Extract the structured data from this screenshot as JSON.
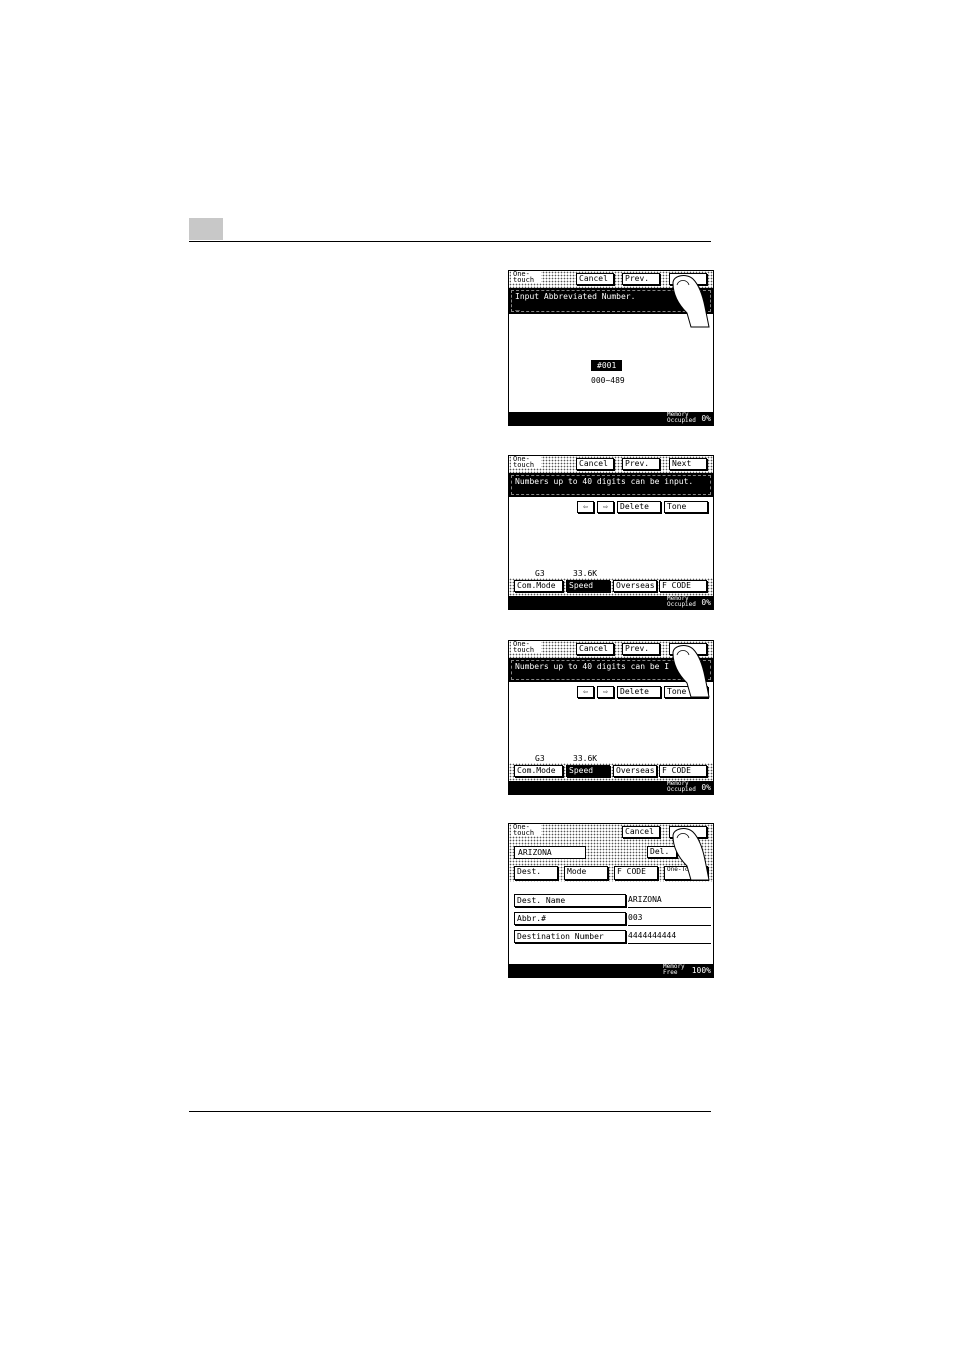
{
  "screen1": {
    "one_touch": "One-touch",
    "cancel": "Cancel",
    "prev": "Prev.",
    "message": "Input Abbreviated Number.",
    "cursor": "_",
    "abbr_number": "#001",
    "range": "000~489",
    "memory_label": "Memory Occupied",
    "memory_value": "0%"
  },
  "screen2": {
    "one_touch": "One-touch",
    "cancel": "Cancel",
    "prev": "Prev.",
    "next": "Next",
    "message": "Numbers up to 40 digits can be input.",
    "left_arrow": "⇦",
    "right_arrow": "⇨",
    "delete": "Delete",
    "tone": "Tone",
    "g3": "G3",
    "speed_value": "33.6K",
    "com_mode": "Com.Mode",
    "speed": "Speed",
    "overseas": "Overseas",
    "f_code": "F CODE",
    "memory_label": "Memory Occupied",
    "memory_value": "0%"
  },
  "screen3": {
    "one_touch": "One-touch",
    "cancel": "Cancel",
    "prev": "Prev.",
    "message": "Numbers up to 40 digits can be I",
    "left_arrow": "⇦",
    "right_arrow": "⇨",
    "delete": "Delete",
    "tone": "Tone",
    "g3": "G3",
    "speed_value": "33.6K",
    "com_mode": "Com.Mode",
    "speed": "Speed",
    "overseas": "Overseas",
    "f_code": "F CODE",
    "memory_label": "Memory Occupied",
    "memory_value": "0%"
  },
  "screen4": {
    "one_touch": "One-touch",
    "cancel": "Cancel",
    "name_box": "ARIZONA",
    "del": "Del.",
    "tabs": {
      "dest": "Dest.",
      "mode": "Mode",
      "f_code": "F CODE",
      "one_touch": "One-Touch"
    },
    "fields": [
      {
        "label": "Dest. Name",
        "value": "ARIZONA"
      },
      {
        "label": "Abbr.#",
        "value": "003"
      },
      {
        "label": "Destination Number",
        "value": "4444444444"
      }
    ],
    "memory_label": "Memory Free",
    "memory_value": "100%"
  }
}
